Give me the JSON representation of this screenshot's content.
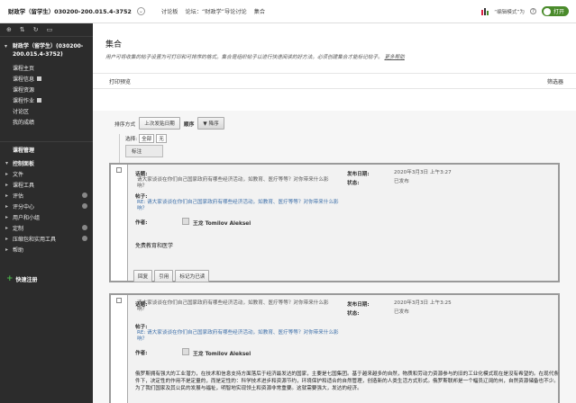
{
  "topbar": {
    "course_title": "财政学（留学生）030200-200.015.4-3752",
    "crumbs": [
      "讨论板",
      "论坛：“财政学”导论讨论",
      "集合"
    ],
    "edit_mode_label": "“编辑模式”为",
    "toggle_label": "打开"
  },
  "sidebar": {
    "course_name": "财政学（留学生）(030200-200.015.4-3752)",
    "links": [
      "课程主页",
      "课程信息",
      "课程资源",
      "课程作业",
      "讨论区",
      "我的成绩"
    ],
    "links_with_box": [
      false,
      true,
      false,
      true,
      false,
      false
    ],
    "management_title": "课程管理",
    "tools": [
      "控制面板",
      "文件",
      "课程工具",
      "评估",
      "评分中心",
      "用户和小组",
      "定制",
      "压缩包和实用工具",
      "帮助"
    ],
    "quick_setup": "快速注册"
  },
  "page": {
    "title": "集合",
    "description": "用户可将收集的帖子设置为可打印和可排序的格式。集合是组织帖子以进行快速阅读的好方法。必须创建集合才能标记帖子。",
    "help_link": "更多帮助",
    "print_preview": "打印预览",
    "filter": "筛选器"
  },
  "sort": {
    "label": "排序方式",
    "field": "上次发贴日期",
    "order_label": "顺序",
    "order_value": "▼ 降序",
    "select_label": "选择:",
    "select_all": "全部",
    "select_none": "无",
    "tag_button": "标注"
  },
  "posts": [
    {
      "subject_label": "话题:",
      "subject": "请大家谈谈在你们自己国家政府有哪些经济活动，如教育、医疗等等？对你带来什么影响？",
      "post_label": "帖子:",
      "post_link": "RE: 请大家谈谈在你们自己国家政府有哪些经济活动，如教育、医疗等等？对你带来什么影响？",
      "author_label": "作者:",
      "author": "王龙 Tomilov Aleksei",
      "date_label": "发布日期:",
      "date": "2020年3月3日 上午3:27",
      "status_label": "状态:",
      "status": "已发布",
      "message": "免费教育和医学",
      "actions": [
        "回复",
        "引用",
        "标记为已读"
      ]
    },
    {
      "subject_label": "话题:",
      "subject": "请大家谈谈在你们自己国家政府有哪些经济活动，如教育、医疗等等？对你带来什么影响？",
      "post_label": "帖子:",
      "post_link": "RE: 请大家谈谈在你们自己国家政府有哪些经济活动，如教育、医疗等等？对你带来什么影响？",
      "author_label": "作者:",
      "author": "王龙 Tomilov Aleksei",
      "date_label": "发布日期:",
      "date": "2020年3月3日 上午3:25",
      "status_label": "状态:",
      "status": "已发布",
      "message": "俄罗斯拥有强大的工业潜力，在技术和信息支持方面落后于经济最发达的国家，主要是七国集团。基于越来越多的自然，物质和劳动力资源参与的旧的工业化模式现在是没有希望的。在现代条件下，决定性的作用不是定量的，而是定性的：科学技术进步和资源节约，环境保护和适合的自然管理，创造新的人类生活方式形式。俄罗斯联邦是一个幅员辽阔的州，自然资源储备也不少。为了我们国家及其公民的发展与福祉，明智地实现领土和资源非常重要。这就需要强大，发达的经济。"
    }
  ],
  "colors": {
    "sidebar_bg": "#2c2c2c",
    "toggle_green": "#4a8b2b",
    "link_blue": "#3b6ea8"
  }
}
